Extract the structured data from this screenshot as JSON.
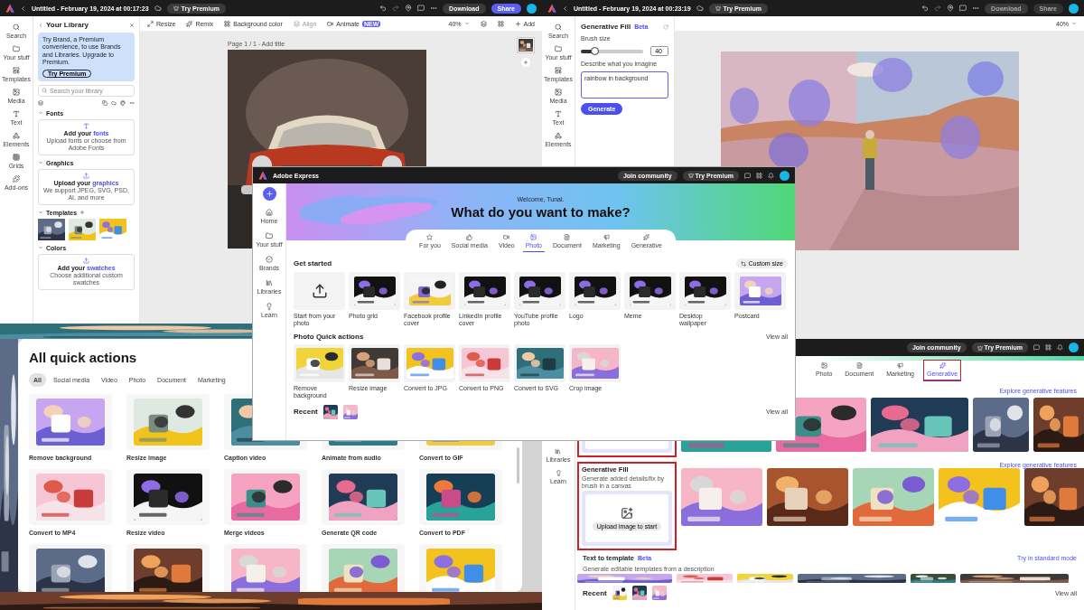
{
  "editor_left": {
    "title": "Untitled - February 19, 2024 at 00:17:23",
    "try_premium": "Try Premium",
    "download": {
      "label": "Download",
      "disabled": false
    },
    "share": {
      "label": "Share",
      "disabled": false
    },
    "toolbar": [
      {
        "label": "Resize",
        "disabled": false
      },
      {
        "label": "Remix",
        "disabled": false
      },
      {
        "label": "Background color",
        "disabled": false
      },
      {
        "label": "Align",
        "disabled": true
      },
      {
        "label": "Animate",
        "disabled": false
      }
    ],
    "toolbar_badge": "NEW",
    "zoom": "40%",
    "add": "Add",
    "rail": [
      "Search",
      "Your stuff",
      "Templates",
      "Media",
      "Text",
      "Elements",
      "Grids",
      "Add-ons"
    ],
    "library": {
      "title": "Your Library",
      "promo": "Try Brand, a Premium convenience, to use Brands and Libraries. Upgrade to Premium.",
      "promo_button": "Try Premium",
      "search_placeholder": "Search your library",
      "sections": [
        {
          "kind": "upload",
          "heading": "Fonts",
          "action": "Add your",
          "action_link": "fonts",
          "note": "Upload fonts or choose from Adobe Fonts"
        },
        {
          "kind": "upload",
          "heading": "Graphics",
          "action": "Upload your",
          "action_link": "graphics",
          "note": "We support JPEG, SVG, PSD, AI, and more"
        },
        {
          "kind": "templates",
          "heading": "Templates"
        },
        {
          "kind": "upload",
          "heading": "Colors",
          "action": "Add your",
          "action_link": "swatches",
          "note": "Choose additional custom swatches"
        }
      ]
    },
    "page_label": "Page 1 / 1 - Add title"
  },
  "editor_right": {
    "title": "Untitled - February 19, 2024 at 00:23:19",
    "try_premium": "Try Premium",
    "download": {
      "label": "Download",
      "disabled": true
    },
    "share": {
      "label": "Share",
      "disabled": true
    },
    "rail": [
      "Search",
      "Your stuff",
      "Templates",
      "Media",
      "Text",
      "Elements"
    ],
    "panel": {
      "title": "Generative Fill",
      "badge": "Beta",
      "brush_label": "Brush size",
      "level": 0.22,
      "brush_value": "40",
      "prompt_label": "Describe what you imagine",
      "prompt_value": "rainbow in background",
      "button": "Generate"
    },
    "zoom": "40%"
  },
  "quick_actions": {
    "title": "All quick actions",
    "tabs": [
      {
        "label": "All",
        "selected": true
      },
      {
        "label": "Social media",
        "selected": false
      },
      {
        "label": "Video",
        "selected": false
      },
      {
        "label": "Photo",
        "selected": false
      },
      {
        "label": "Document",
        "selected": false
      },
      {
        "label": "Marketing",
        "selected": false
      }
    ],
    "cards": [
      "Remove background",
      "Resize image",
      "Caption video",
      "Animate from audio",
      "Convert to GIF",
      "Convert to MP4",
      "Resize video",
      "Merge videos",
      "Generate QR code",
      "Convert to PDF"
    ]
  },
  "express_generative": {
    "join": "Join community",
    "try_premium": "Try Premium",
    "rail": [
      "Libraries",
      "Learn"
    ],
    "tabs": [
      {
        "label": "Photo",
        "selected": false,
        "highlighted": false
      },
      {
        "label": "Document",
        "selected": false,
        "highlighted": false
      },
      {
        "label": "Marketing",
        "selected": false,
        "highlighted": false
      },
      {
        "label": "Generative",
        "selected": true,
        "highlighted": true
      }
    ],
    "explore_links": [
      "Explore generative features",
      "Explore generative features"
    ],
    "fill": {
      "title": "Generative Fill",
      "description": "Generate added details/fix by brush in a canvas",
      "button": "Upload image to start",
      "highlighted": true
    },
    "text_to_image_highlighted": true,
    "template": {
      "title": "Text to template",
      "badge": "Beta",
      "description": "Generate editable templates from a description",
      "link": "Try in standard mode"
    },
    "recent": "Recent",
    "view_all": "View all"
  },
  "express_home": {
    "app_name": "Adobe Express",
    "join": "Join community",
    "try_premium": "Try Premium",
    "rail": [
      "Home",
      "Your stuff",
      "Brands",
      "Libraries",
      "Learn"
    ],
    "welcome": "Welcome, Tunal.",
    "headline": "What do you want to make?",
    "tabs": [
      {
        "label": "For you",
        "selected": false
      },
      {
        "label": "Social media",
        "selected": false
      },
      {
        "label": "Video",
        "selected": false
      },
      {
        "label": "Photo",
        "selected": true
      },
      {
        "label": "Document",
        "selected": false
      },
      {
        "label": "Marketing",
        "selected": false
      },
      {
        "label": "Generative",
        "selected": false
      }
    ],
    "get_started": "Get started",
    "custom_size": "Custom size",
    "templates": [
      "Start from your photo",
      "Photo grid",
      "Facebook profile cover",
      "LinkedIn profile cover",
      "YouTube profile photo",
      "Logo",
      "Meme",
      "Desktop wallpaper",
      "Postcard"
    ],
    "quick_title": "Photo Quick actions",
    "quick_view_all": "View all",
    "quick_actions": [
      "Remove background",
      "Resize image",
      "Convert to JPG",
      "Convert to PNG",
      "Convert to SVG",
      "Crop image"
    ],
    "recent": "Recent",
    "recent_view_all": "View all"
  }
}
